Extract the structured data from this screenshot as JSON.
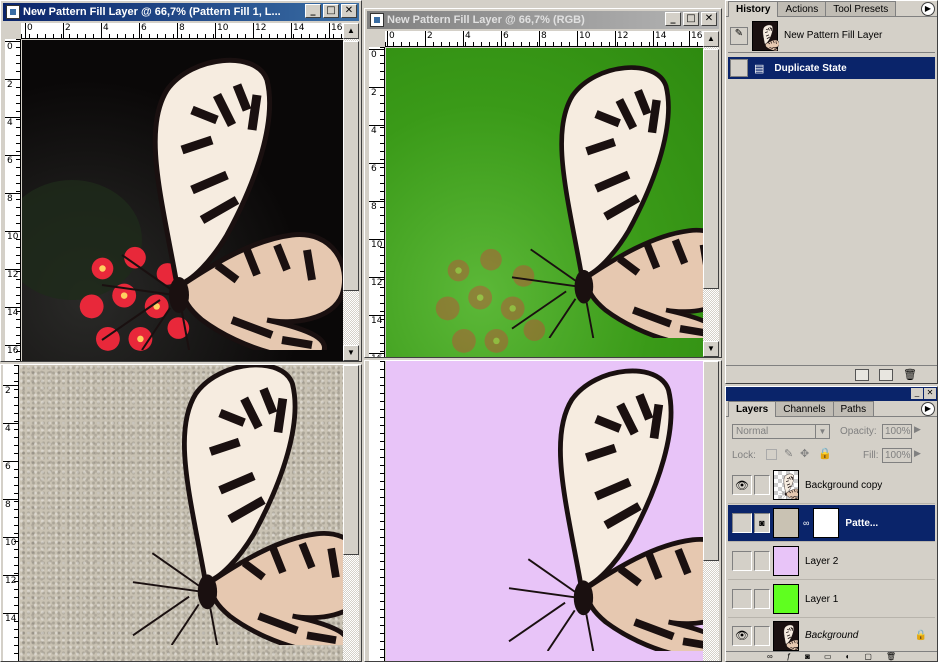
{
  "windows": {
    "win1": {
      "title": "New Pattern Fill Layer @ 66,7% (Pattern Fill 1, L...",
      "ruler_h": [
        "0",
        "2",
        "4",
        "6",
        "8",
        "10",
        "12",
        "14",
        "16"
      ],
      "ruler_v": [
        "0",
        "2",
        "4",
        "6",
        "8",
        "10",
        "12",
        "14",
        "16"
      ]
    },
    "win2": {
      "title": "New Pattern Fill Layer @ 66,7% (RGB)",
      "ruler_h": [
        "0",
        "2",
        "4",
        "6",
        "8",
        "10",
        "12",
        "14",
        "16"
      ],
      "ruler_v": [
        "0",
        "2",
        "4",
        "6",
        "8",
        "10",
        "12",
        "14",
        "16"
      ]
    },
    "win3": {
      "ruler_v": [
        "2",
        "4",
        "6",
        "8",
        "10",
        "12",
        "14"
      ]
    },
    "title_buttons": {
      "min": "_",
      "max": "□",
      "close": "✕"
    }
  },
  "history_panel": {
    "tabs": [
      "History",
      "Actions",
      "Tool Presets"
    ],
    "snapshot_label": "New Pattern Fill Layer",
    "states": [
      {
        "label": "Duplicate State"
      }
    ]
  },
  "layers_panel": {
    "tabs": [
      "Layers",
      "Channels",
      "Paths"
    ],
    "blend_mode": "Normal",
    "opacity_label": "Opacity:",
    "opacity_value": "100%",
    "lock_label": "Lock:",
    "fill_label": "Fill:",
    "fill_value": "100%",
    "layers": [
      {
        "name": "Background copy",
        "visible": true
      },
      {
        "name": "Patte...",
        "visible": false,
        "selected": true
      },
      {
        "name": "Layer 2",
        "visible": false,
        "color": "#e8c4f8"
      },
      {
        "name": "Layer 1",
        "visible": false,
        "color": "#5fff1f"
      },
      {
        "name": "Background",
        "visible": true,
        "italic": true
      }
    ]
  },
  "colors": {
    "canvas_dark": "#0a0808",
    "canvas_green": "#3a9a18",
    "canvas_stone": "#c9c2b3",
    "canvas_lilac": "#e8c4f8",
    "selection_blue": "#0a246a"
  }
}
